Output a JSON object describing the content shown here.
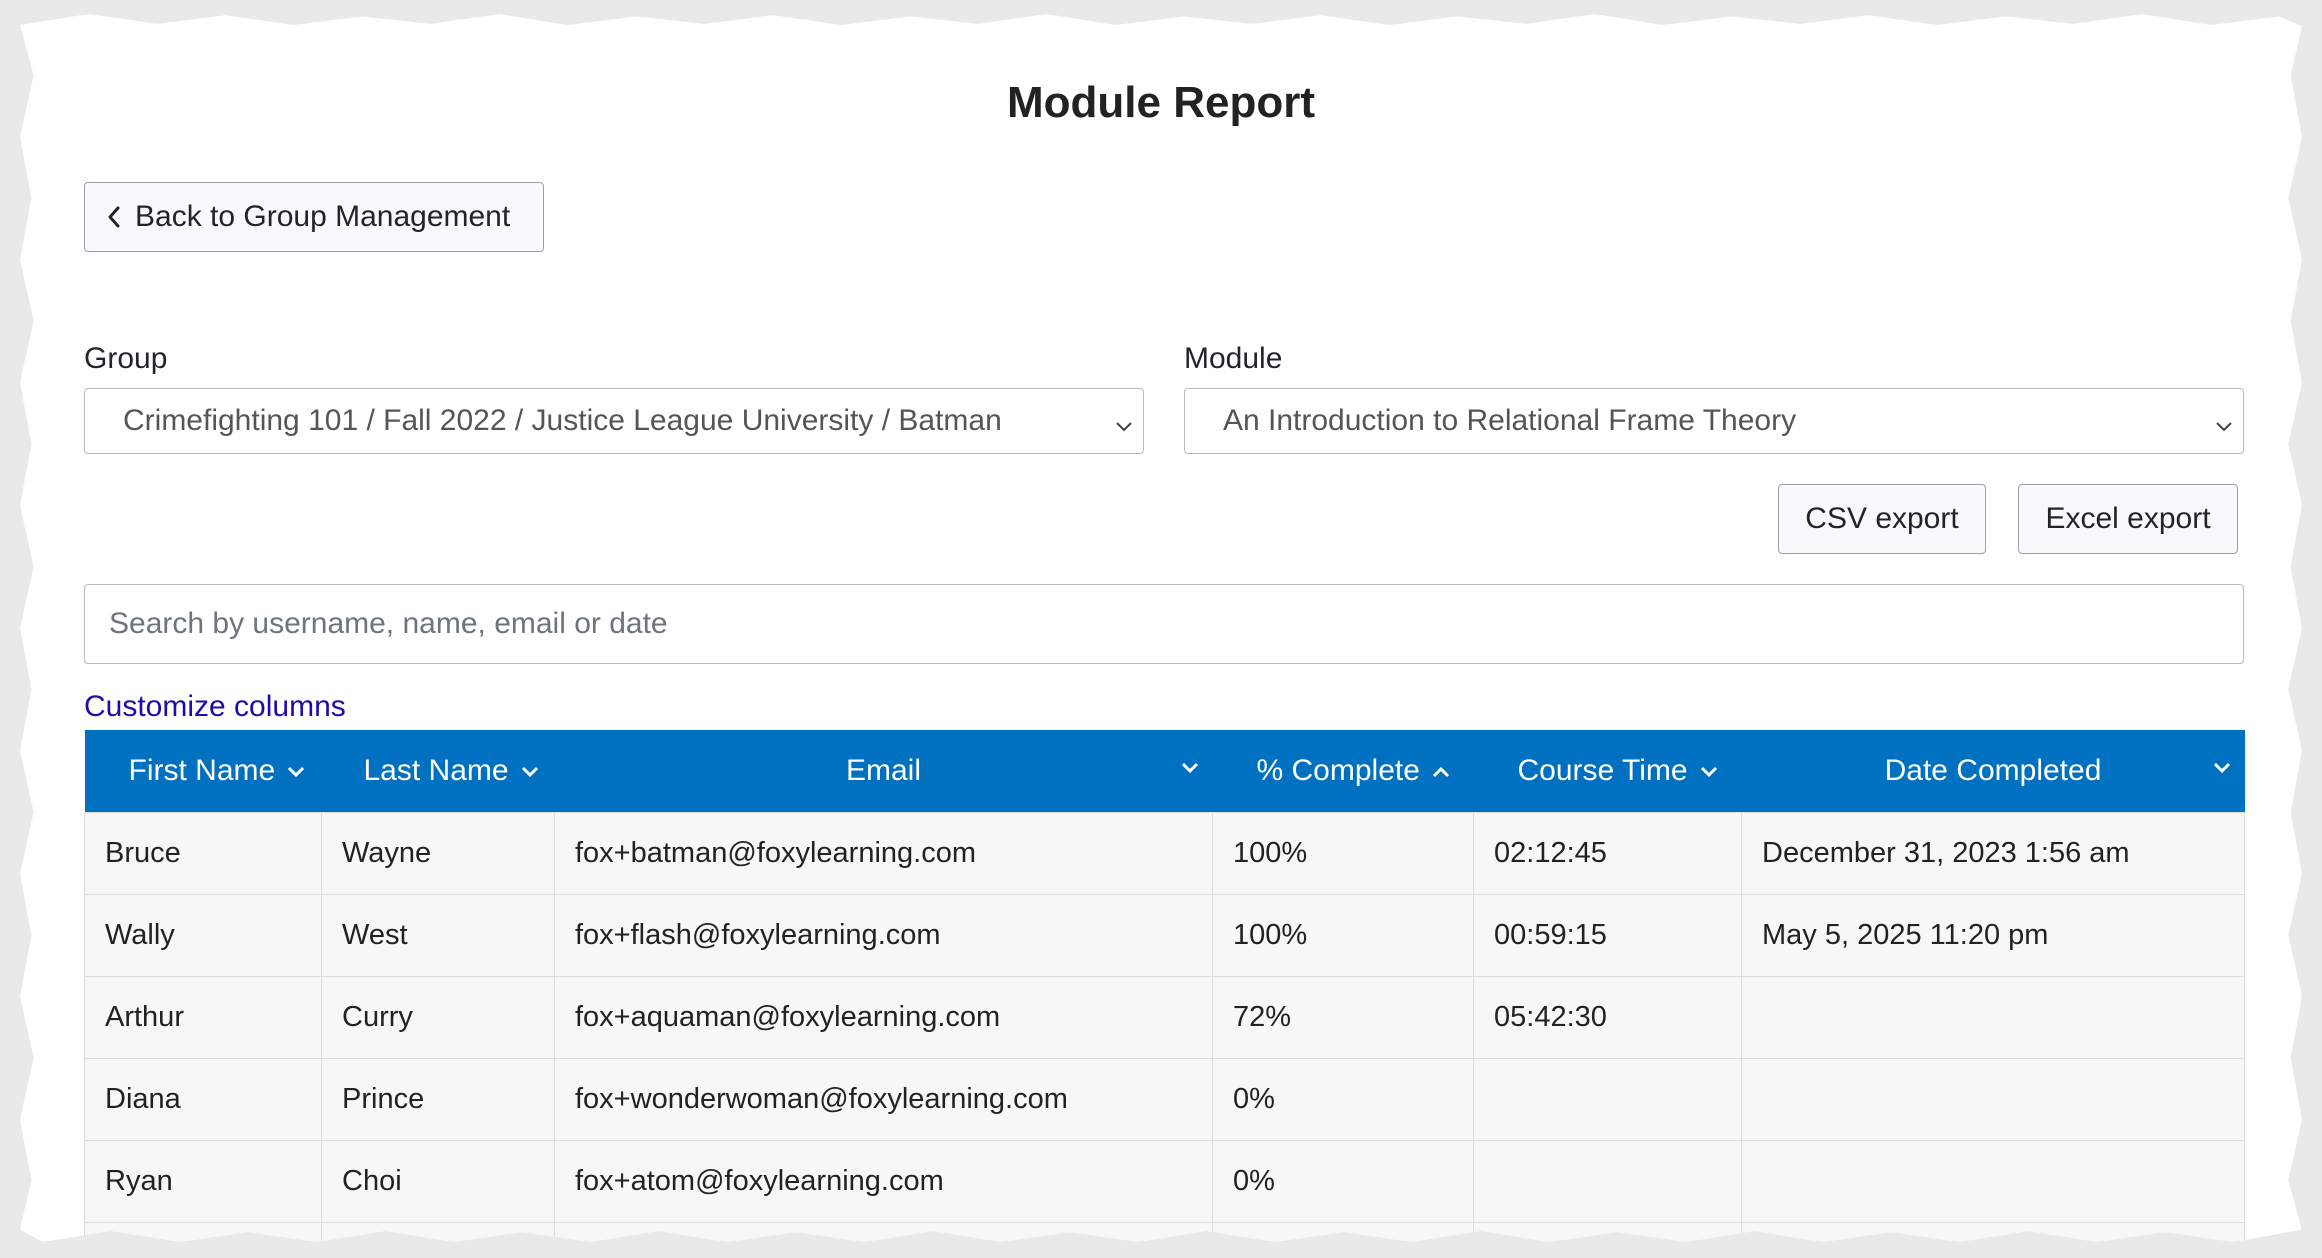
{
  "page": {
    "title": "Module Report"
  },
  "back_button": {
    "label": "Back to Group Management",
    "icon": "chevron-left-icon"
  },
  "group": {
    "label": "Group",
    "selected": "Crimefighting 101 / Fall 2022 / Justice League University / Batman"
  },
  "module": {
    "label": "Module",
    "selected": "An Introduction to Relational Frame Theory"
  },
  "exports": {
    "csv": "CSV export",
    "excel": "Excel export"
  },
  "search": {
    "placeholder": "Search by username, name, email or date",
    "value": ""
  },
  "customize_columns": "Customize columns",
  "table": {
    "header_color": "#0070c0",
    "columns": [
      {
        "label": "First Name",
        "sort": "desc"
      },
      {
        "label": "Last Name",
        "sort": "desc"
      },
      {
        "label": "Email",
        "sort": "desc"
      },
      {
        "label": "% Complete",
        "sort": "asc"
      },
      {
        "label": "Course Time",
        "sort": "desc"
      },
      {
        "label": "Date Completed",
        "sort": "desc"
      }
    ],
    "rows": [
      [
        "Bruce",
        "Wayne",
        "fox+batman@foxylearning.com",
        "100%",
        "02:12:45",
        "December 31, 2023 1:56 am"
      ],
      [
        "Wally",
        "West",
        "fox+flash@foxylearning.com",
        "100%",
        "00:59:15",
        "May 5, 2025 11:20 pm"
      ],
      [
        "Arthur",
        "Curry",
        "fox+aquaman@foxylearning.com",
        "72%",
        "05:42:30",
        ""
      ],
      [
        "Diana",
        "Prince",
        "fox+wonderwoman@foxylearning.com",
        "0%",
        "",
        ""
      ],
      [
        "Ryan",
        "Choi",
        "fox+atom@foxylearning.com",
        "0%",
        "",
        ""
      ],
      [
        "",
        "",
        "",
        "",
        "",
        ""
      ]
    ]
  }
}
